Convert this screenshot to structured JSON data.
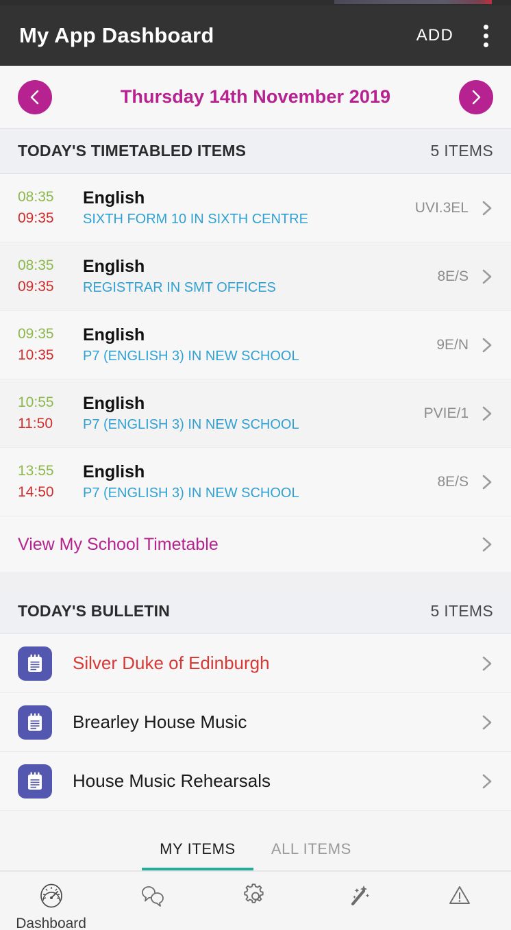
{
  "appbar": {
    "title": "My App Dashboard",
    "add_label": "ADD",
    "overflow_icon": "more-vert-icon"
  },
  "datebar": {
    "prev_icon": "chevron-left-icon",
    "next_icon": "chevron-right-icon",
    "date": "Thursday 14th November 2019",
    "accent_color": "#b6228f"
  },
  "timetable": {
    "header": "TODAY'S TIMETABLED ITEMS",
    "count": "5 ITEMS",
    "colors": {
      "start_time": "#8cb84a",
      "end_time": "#d02c2c",
      "location": "#31a0d2"
    },
    "rows": [
      {
        "start": "08:35",
        "end": "09:35",
        "subject": "English",
        "location": "SIXTH FORM 10 IN SIXTH CENTRE",
        "code": "UVI.3EL"
      },
      {
        "start": "08:35",
        "end": "09:35",
        "subject": "English",
        "location": "REGISTRAR IN SMT OFFICES",
        "code": "8E/S"
      },
      {
        "start": "09:35",
        "end": "10:35",
        "subject": "English",
        "location": "P7 (ENGLISH 3) IN NEW SCHOOL",
        "code": "9E/N"
      },
      {
        "start": "10:55",
        "end": "11:50",
        "subject": "English",
        "location": "P7 (ENGLISH 3) IN NEW SCHOOL",
        "code": "PVIE/1"
      },
      {
        "start": "13:55",
        "end": "14:50",
        "subject": "English",
        "location": "P7 (ENGLISH 3) IN NEW SCHOOL",
        "code": "8E/S"
      }
    ],
    "link_label": "View My School Timetable"
  },
  "bulletin": {
    "header": "TODAY'S BULLETIN",
    "count": "5 ITEMS",
    "icon_color": "#5457b0",
    "items": [
      {
        "title": "Silver Duke of Edinburgh",
        "icon": "notepad-icon",
        "highlight": true
      },
      {
        "title": "Brearley House Music",
        "icon": "notepad-icon",
        "highlight": false
      },
      {
        "title": "House Music Rehearsals",
        "icon": "notepad-icon",
        "highlight": false
      }
    ]
  },
  "tabs": {
    "active_color": "#27ac9b",
    "items": [
      {
        "label": "MY ITEMS",
        "active": true
      },
      {
        "label": "ALL ITEMS",
        "active": false
      }
    ]
  },
  "bottomnav": {
    "items": [
      {
        "label": "Dashboard",
        "icon": "speedometer-icon"
      },
      {
        "label": "",
        "icon": "chat-bubbles-icon"
      },
      {
        "label": "",
        "icon": "gear-icon"
      },
      {
        "label": "",
        "icon": "magic-wand-icon"
      },
      {
        "label": "",
        "icon": "warning-triangle-icon"
      }
    ]
  }
}
